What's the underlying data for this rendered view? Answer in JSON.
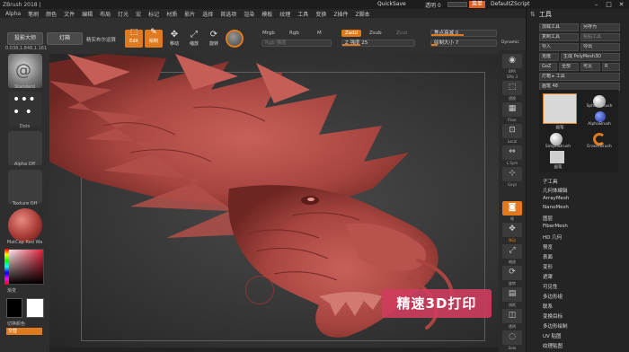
{
  "title_bar": {
    "app_title": "ZBrush 2018 |",
    "quicksave": "QuickSave",
    "transparency": "透明 0",
    "menu": "菜单",
    "default_script": "DefaultZScript"
  },
  "menus": [
    "Alpha",
    "笔刷",
    "颜色",
    "文件",
    "编辑",
    "布局",
    "灯光",
    "宏",
    "标记",
    "材质",
    "影片",
    "选择",
    "首选项",
    "渲染",
    "模板",
    "纹理",
    "工具",
    "变换",
    "Z插件",
    "Z脚本"
  ],
  "toolbar": {
    "projection": "投影大师",
    "lightbox": "灯箱",
    "live_boolean": "精实布尔运算",
    "edit": "Edit",
    "draw": "绘制",
    "move": "移动",
    "scale": "缩放",
    "rotate": "旋转",
    "mrgb": "Mrgb",
    "rgb": "Rgb",
    "m": "M",
    "zadd": "Zadd",
    "zsub": "Zsub",
    "zcut": "Zcut",
    "rgb_intensity": "Rgb 强度",
    "z_intensity": "Z 强度 25",
    "focal_shift": "焦点衰减 0",
    "draw_size": "绘制大小 7",
    "dynamic": "Dynamic",
    "coords": "0.038,1.848,1.161"
  },
  "left_panel": {
    "brush": "Standard",
    "stroke": "Dots",
    "alpha": "Alpha Off",
    "texture": "Texture Off",
    "material": "MatCap Red Wa",
    "gradient": "渐变",
    "switch_color": "切换颜色",
    "alternate": "交替"
  },
  "viewport": {
    "promo_text": "精速3D打印"
  },
  "right_shelf": [
    "BPR",
    "SPix 3",
    "透视",
    "Floor",
    "Local",
    "L.Sym",
    "Gxyz",
    "帧",
    "移动",
    "缩放",
    "旋转",
    "线框",
    "透明",
    "Solo"
  ],
  "tool_panel": {
    "title": "工具",
    "load_tool": "加载工具",
    "save_as": "另存为",
    "copy_tool": "复制工具",
    "paste_tool": "粘贴工具",
    "import": "导入",
    "export": "导出",
    "clone": "克隆",
    "make_polymesh": "生成 PolyMesh3D",
    "goz": "GoZ",
    "all": "全部",
    "visible": "可见",
    "r": "R",
    "lightbox_tools": "灯箱 ▸ 工具",
    "brush_size": "画笔 48",
    "brushes": [
      "画笔",
      "SphereBrush",
      "AlphaBrush",
      "SimpleBrush",
      "EraserBrush",
      "画笔"
    ],
    "subpanels": [
      "子工具",
      "几何体编辑",
      "ArrayMesh",
      "NanoMesh",
      "图层",
      "FiberMesh",
      "HD 几何",
      "预览",
      "表面",
      "变形",
      "遮罩",
      "可见性",
      "多边形组",
      "联系",
      "变换目标",
      "多边形绘制",
      "UV 贴图",
      "纹理贴图"
    ]
  },
  "colors": {
    "accent": "#e07a1e",
    "promo_bg": "#d23c5f",
    "sculpt": "#a84540"
  }
}
